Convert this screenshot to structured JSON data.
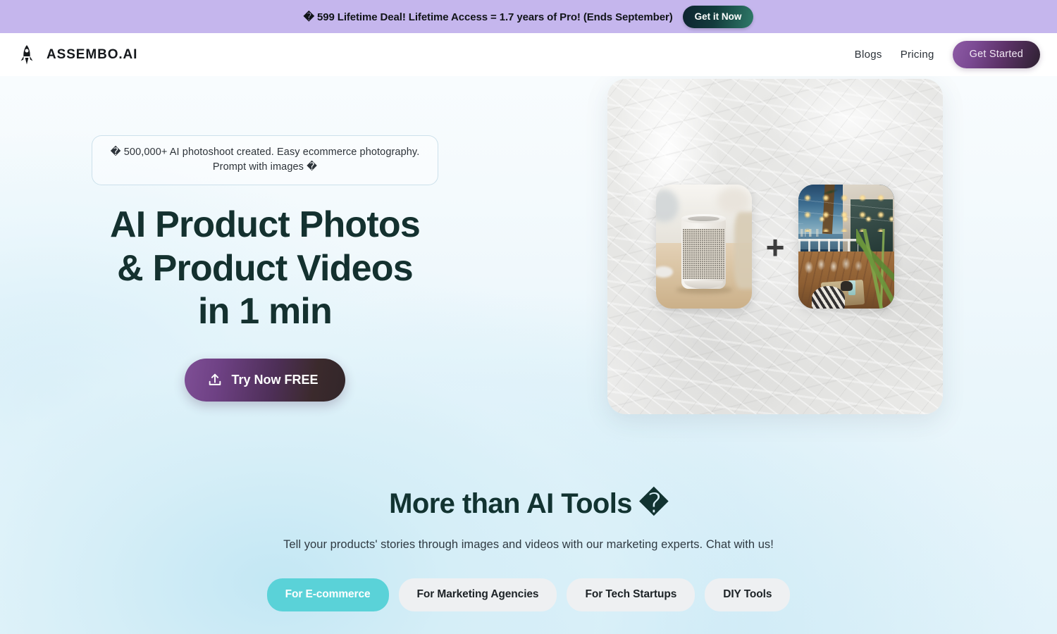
{
  "promo": {
    "text": "� 599 Lifetime Deal! Lifetime Access = 1.7 years of Pro! (Ends September)",
    "button_label": "Get it Now",
    "background": "#c5b6ed"
  },
  "header": {
    "logo_icon": "rocket-icon",
    "brand": "ASSEMBO.AI",
    "nav": [
      {
        "label": "Blogs"
      },
      {
        "label": "Pricing"
      }
    ],
    "cta_label": "Get Started"
  },
  "hero": {
    "badge": "� 500,000+ AI photoshoot created. Easy ecommerce photography. Prompt with images �",
    "title_lines": [
      "AI Product Photos",
      "& Product Videos",
      "in 1 min"
    ],
    "title_full": "AI Product Photos & Product Videos in 1 min",
    "cta_label": "Try Now FREE",
    "cta_icon": "upload-icon",
    "title_color": "#14312f",
    "media": {
      "card_style": "crumpled-paper",
      "left_image_alt": "smart speaker on wooden table",
      "operator": "+",
      "right_image_alt": "outdoor waterfront restaurant patio at dusk with string lights"
    }
  },
  "tools": {
    "title": "More than AI Tools �",
    "subtitle": "Tell your products' stories through images and videos with our marketing experts. Chat with us!",
    "pills": [
      {
        "label": "For E-commerce",
        "active": true
      },
      {
        "label": "For Marketing Agencies",
        "active": false
      },
      {
        "label": "For Tech Startups",
        "active": false
      },
      {
        "label": "DIY Tools",
        "active": false
      }
    ],
    "active_color": "#5ad2d8",
    "inactive_color": "#eef0f2"
  }
}
